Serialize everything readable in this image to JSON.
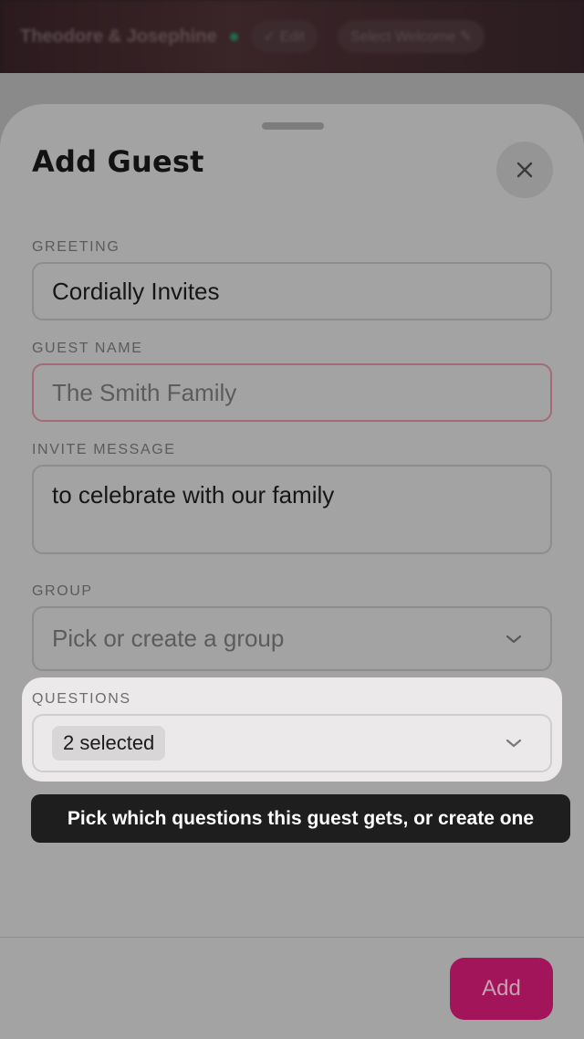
{
  "background": {
    "app_title": "Theodore & Josephine",
    "edit_label": "Edit",
    "reveal_label": "Select Welcome"
  },
  "sheet": {
    "title": "Add Guest",
    "fields": {
      "greeting": {
        "label": "GREETING",
        "value": "Cordially Invites"
      },
      "guest_name": {
        "label": "GUEST NAME",
        "placeholder": "The Smith Family"
      },
      "invite_message": {
        "label": "INVITE MESSAGE",
        "value": "to celebrate with our family"
      },
      "group": {
        "label": "GROUP",
        "placeholder": "Pick or create a group"
      },
      "questions": {
        "label": "QUESTIONS",
        "selected_text": "2 selected"
      }
    },
    "tooltip": "Pick which questions this guest gets, or create one",
    "add_button": "Add"
  },
  "colors": {
    "accent": "#a3155a",
    "tooltip_bg": "#1e1e1e",
    "status_dot": "#1f6b4e"
  },
  "icons": {
    "close": "close-icon",
    "chevron": "chevron-down-icon"
  }
}
